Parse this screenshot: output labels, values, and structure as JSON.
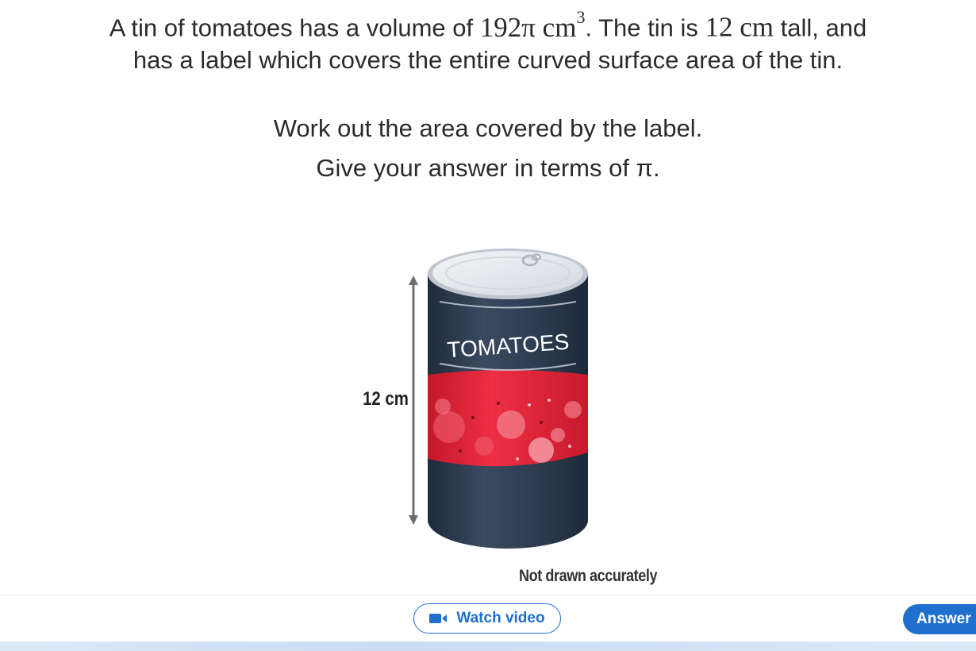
{
  "question": {
    "line1_a": "A tin of tomatoes has a volume of ",
    "line1_math_a": "192π cm",
    "line1_sup": "3",
    "line1_b": ". The tin is ",
    "line1_math_b": "12 cm",
    "line1_c": " tall, and",
    "line2": "has a label which covers the entire curved surface area of the tin.",
    "line3": "Work out the area covered by the label.",
    "line4": "Give your answer in terms of π."
  },
  "figure": {
    "height_label": "12 cm",
    "can_label": "TOMATOES",
    "caption": "Not drawn accurately",
    "colors": {
      "can_body": "#2e3d52",
      "label_band": "#e8283c",
      "lid": "#e4e7eb"
    }
  },
  "footer": {
    "watch_video_label": "Watch video",
    "answer_label": "Answer",
    "accent_color": "#1f6fcf"
  }
}
